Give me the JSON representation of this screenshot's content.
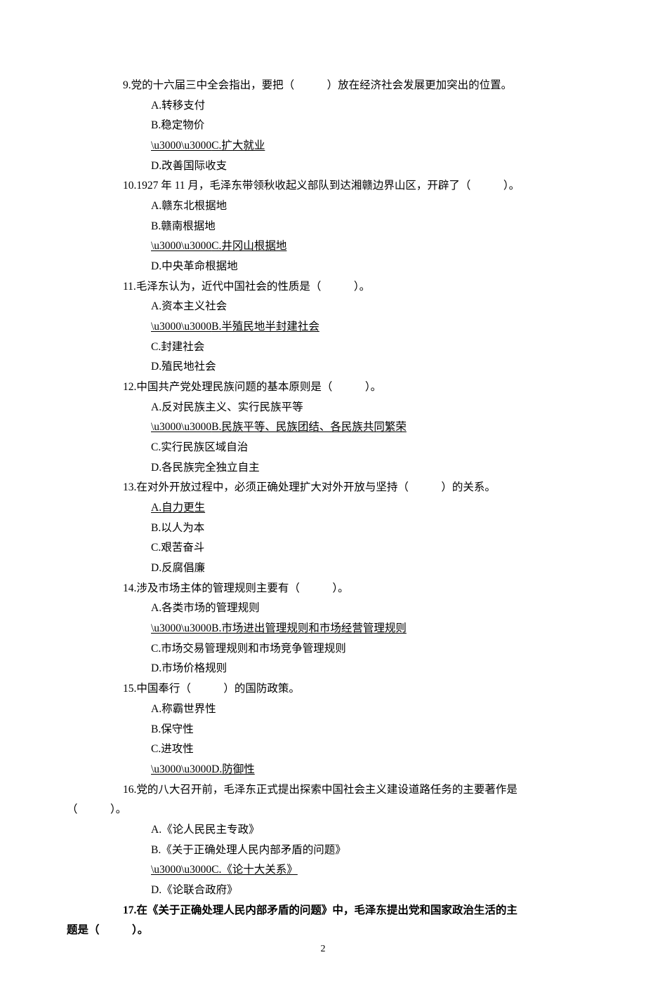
{
  "questions": [
    {
      "number": "9.",
      "stem": "党的十六届三中全会指出，要把（　　　）放在经济社会发展更加突出的位置。",
      "options": [
        {
          "label": "A.转移支付",
          "correct": false
        },
        {
          "label": "B.稳定物价",
          "correct": false
        },
        {
          "label": "C.扩大就业",
          "correct": true
        },
        {
          "label": "D.改善国际收支",
          "correct": false
        }
      ]
    },
    {
      "number": "10.",
      "stem": "1927 年 11 月，毛泽东带领秋收起义部队到达湘赣边界山区，开辟了（　　　）。",
      "options": [
        {
          "label": "A.赣东北根据地",
          "correct": false
        },
        {
          "label": "B.赣南根据地",
          "correct": false
        },
        {
          "label": "C.井冈山根据地",
          "correct": true
        },
        {
          "label": "D.中央革命根据地",
          "correct": false
        }
      ]
    },
    {
      "number": "11.",
      "stem": "毛泽东认为，近代中国社会的性质是（　　　）。",
      "options": [
        {
          "label": "A.资本主义社会",
          "correct": false
        },
        {
          "label": "B.半殖民地半封建社会",
          "correct": true
        },
        {
          "label": "C.封建社会",
          "correct": false
        },
        {
          "label": "D.殖民地社会",
          "correct": false
        }
      ]
    },
    {
      "number": "12.",
      "stem": "中国共产党处理民族问题的基本原则是（　　　）。",
      "options": [
        {
          "label": "A.反对民族主义、实行民族平等",
          "correct": false
        },
        {
          "label": "B.民族平等、民族团结、各民族共同繁荣",
          "correct": true
        },
        {
          "label": "C.实行民族区域自治",
          "correct": false
        },
        {
          "label": "D.各民族完全独立自主",
          "correct": false
        }
      ]
    },
    {
      "number": "13.",
      "stem": "在对外开放过程中，必须正确处理扩大对外开放与坚持（　　　）的关系。",
      "options": [
        {
          "label": "A.自力更生",
          "correct": true
        },
        {
          "label": "B.以人为本",
          "correct": false
        },
        {
          "label": "C.艰苦奋斗",
          "correct": false
        },
        {
          "label": "D.反腐倡廉",
          "correct": false
        }
      ]
    },
    {
      "number": "14.",
      "stem": "涉及市场主体的管理规则主要有（　　　）。",
      "options": [
        {
          "label": "A.各类市场的管理规则",
          "correct": false
        },
        {
          "label": "B.市场进出管理规则和市场经营管理规则",
          "correct": true
        },
        {
          "label": "C.市场交易管理规则和市场竞争管理规则",
          "correct": false
        },
        {
          "label": "D.市场价格规则",
          "correct": false
        }
      ]
    },
    {
      "number": "15.",
      "stem": "中国奉行（　　　）的国防政策。",
      "options": [
        {
          "label": "A.称霸世界性",
          "correct": false
        },
        {
          "label": "B.保守性",
          "correct": false
        },
        {
          "label": "C.进攻性",
          "correct": false
        },
        {
          "label": "D.防御性",
          "correct": true
        }
      ]
    },
    {
      "number": "16.",
      "stem_line1": "党的八大召开前，毛泽东正式提出探索中国社会主义建设道路任务的主要著作是",
      "stem_line2": "（　　　）。",
      "options": [
        {
          "label": "A.《论人民民主专政》",
          "correct": false
        },
        {
          "label": "B.《关于正确处理人民内部矛盾的问题》",
          "correct": false
        },
        {
          "label": "C.《论十大关系》",
          "correct": true
        },
        {
          "label": "D.《论联合政府》",
          "correct": false
        }
      ]
    },
    {
      "number": "17.",
      "stem_line1": "在《关于正确处理人民内部矛盾的问题》中，毛泽东提出党和国家政治生活的主",
      "stem_line2": "题是（　　　）。",
      "bold": true,
      "options": []
    }
  ],
  "page_number": "2"
}
